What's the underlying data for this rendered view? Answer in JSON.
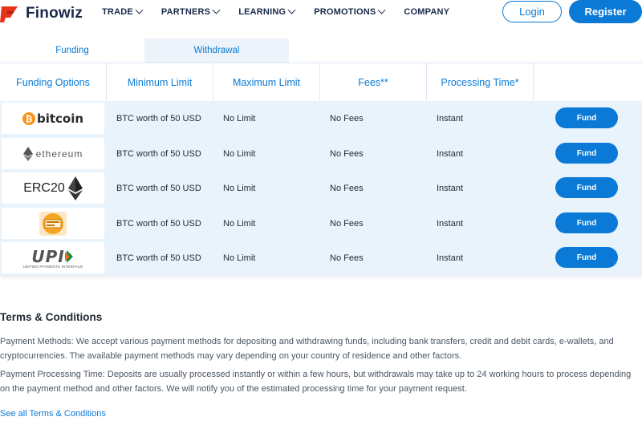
{
  "header": {
    "brand": "Finowiz",
    "nav": [
      {
        "label": "TRADE",
        "has_dropdown": true
      },
      {
        "label": "PARTNERS",
        "has_dropdown": true
      },
      {
        "label": "LEARNING",
        "has_dropdown": true
      },
      {
        "label": "PROMOTIONS",
        "has_dropdown": true
      },
      {
        "label": "COMPANY",
        "has_dropdown": false
      }
    ],
    "login_label": "Login",
    "register_label": "Register"
  },
  "tabs": [
    {
      "label": "Funding",
      "active": false
    },
    {
      "label": "Withdrawal",
      "active": true
    }
  ],
  "table": {
    "headers": [
      "Funding Options",
      "Minimum Limit",
      "Maximum Limit",
      "Fees**",
      "Processing Time*",
      ""
    ],
    "rows": [
      {
        "option": "bitcoin",
        "option_icon": "bitcoin-logo-icon",
        "min": "BTC worth of 50 USD",
        "max": "No Limit",
        "fees": "No Fees",
        "time": "Instant",
        "action": "Fund"
      },
      {
        "option": "ethereum",
        "option_icon": "ethereum-logo-icon",
        "min": "BTC worth of 50 USD",
        "max": "No Limit",
        "fees": "No Fees",
        "time": "Instant",
        "action": "Fund"
      },
      {
        "option": "ERC20",
        "option_icon": "erc20-logo-icon",
        "min": "BTC worth of 50 USD",
        "max": "No Limit",
        "fees": "No Fees",
        "time": "Instant",
        "action": "Fund"
      },
      {
        "option": "",
        "option_icon": "payment-card-logo-icon",
        "min": "BTC worth of 50 USD",
        "max": "No Limit",
        "fees": "No Fees",
        "time": "Instant",
        "action": "Fund"
      },
      {
        "option": "UPI",
        "option_sub": "UNIFIED PAYMENTS INTERFACE",
        "option_icon": "upi-logo-icon",
        "min": "BTC worth of 50 USD",
        "max": "No Limit",
        "fees": "No Fees",
        "time": "Instant",
        "action": "Fund"
      }
    ]
  },
  "terms": {
    "title": "Terms & Conditions",
    "p1": "Payment Methods: We accept various payment methods for depositing and withdrawing funds, including bank transfers, credit and debit cards, e-wallets, and cryptocurrencies. The available payment methods may vary depending on your country of residence and other factors.",
    "p2": "Payment Processing Time: Deposits are usually processed instantly or within a few hours, but withdrawals may take up to 24 working hours to process depending on the payment method and other factors. We will notify you of the estimated processing time for your payment request.",
    "link": "See all Terms & Conditions"
  },
  "colors": {
    "accent": "#0a7ad6",
    "row_bg": "#e9f3fc",
    "brand_dark": "#1a2b49",
    "bitcoin_orange": "#f7931a"
  }
}
